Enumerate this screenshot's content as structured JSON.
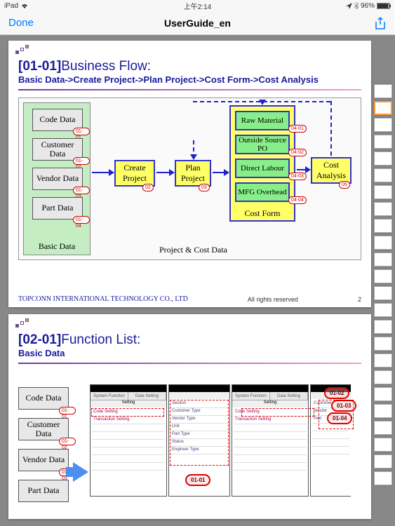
{
  "status": {
    "device": "iPad",
    "wifi": "wifi",
    "time": "上午2:14",
    "nav": "nav",
    "battery": "96%"
  },
  "nav": {
    "done": "Done",
    "title": "UserGuide_en"
  },
  "page1": {
    "code": "[01-01]",
    "title": "Business Flow:",
    "subtitle": "Basic Data->Create Project->Plan Project->Cost Form->Cost Analysis",
    "basic": {
      "label": "Basic Data",
      "boxes": [
        "Code Data",
        "Customer Data",
        "Vendor Data",
        "Part Data"
      ],
      "badges": [
        "01-01",
        "01-02",
        "01-03",
        "01-04"
      ]
    },
    "flow": {
      "create": "Create Project",
      "create_badge": "02",
      "plan": "Plan Project",
      "plan_badge": "03",
      "cost_form": "Cost Form",
      "cost_items": [
        "Raw Material",
        "Outside Source PO",
        "Direct Labour",
        "MFG Overhead"
      ],
      "cost_badges": [
        "04-01",
        "04-02",
        "04-03",
        "04-04"
      ],
      "analysis": "Cost Analysis",
      "analysis_badge": "05",
      "proj_label": "Project & Cost Data"
    },
    "footer_co": "TOPCONN INTERNATIONAL TECHNOLOGY CO., LTD",
    "footer_rights": "All rights reserved",
    "footer_page": "2"
  },
  "page2": {
    "code": "[02-01]",
    "title": "Function List:",
    "subtitle": "Basic Data",
    "basic_boxes": [
      "Code Data",
      "Customer Data",
      "Vendor Data",
      "Part Data"
    ],
    "basic_badges": [
      "01-01",
      "01-02",
      "01-03",
      "01-04"
    ],
    "screen1_tabs": [
      "System Function",
      "Data Setting"
    ],
    "screen1_title": "Setting",
    "screen1_items": [
      "Code Setting",
      "Transaction Setting"
    ],
    "screen2_items": [
      "Section",
      "Customer Type",
      "Vendor Type",
      "Unit",
      "Part Type",
      "Status",
      "Engineer Type"
    ],
    "screen3_tabs": [
      "System Function",
      "Data Setting"
    ],
    "screen3_items": [
      "Code Setting",
      "Transaction Setting"
    ],
    "screen4_items": [
      "Customer",
      "Vendor",
      "Part"
    ],
    "callouts": [
      "01-01",
      "01-02",
      "01-03",
      "01-04"
    ]
  }
}
